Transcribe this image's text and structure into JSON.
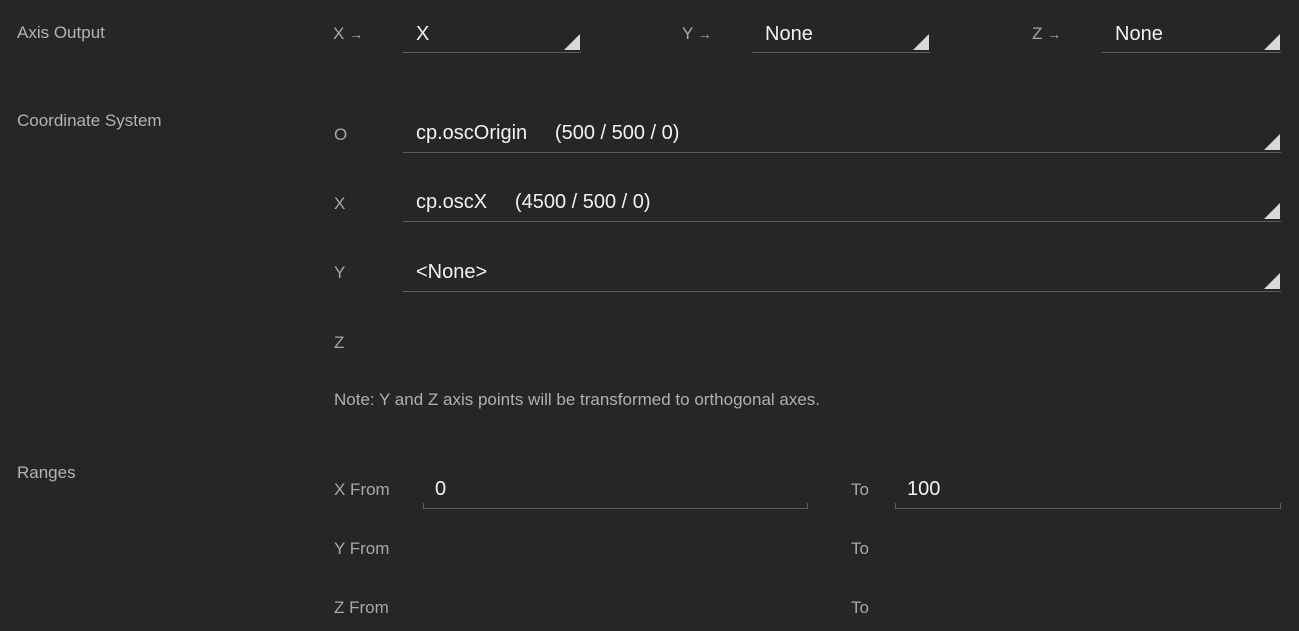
{
  "axis_output": {
    "section_label": "Axis Output",
    "x_label": "X",
    "x_value": "X",
    "y_label": "Y",
    "y_value": "None",
    "z_label": "Z",
    "z_value": "None",
    "arrow": "→"
  },
  "coordinate_system": {
    "section_label": "Coordinate System",
    "o_label": "O",
    "o_value": "cp.oscOrigin     (500 / 500 / 0)",
    "x_label": "X",
    "x_value": "cp.oscX     (4500 / 500 / 0)",
    "y_label": "Y",
    "y_value": "<None>",
    "z_label": "Z",
    "note": "Note: Y and Z axis points will be transformed to orthogonal axes."
  },
  "ranges": {
    "section_label": "Ranges",
    "x_from_label": "X From",
    "x_from_value": "0",
    "x_to_label": "To",
    "x_to_value": "100",
    "y_from_label": "Y From",
    "y_to_label": "To",
    "z_from_label": "Z From",
    "z_to_label": "To"
  },
  "colors": {
    "background": "#262626",
    "text_primary": "#f2f2f2",
    "text_secondary": "#b0b0b0",
    "underline": "#5c5c5c",
    "dropdown_triangle": "#d9d9d9"
  }
}
